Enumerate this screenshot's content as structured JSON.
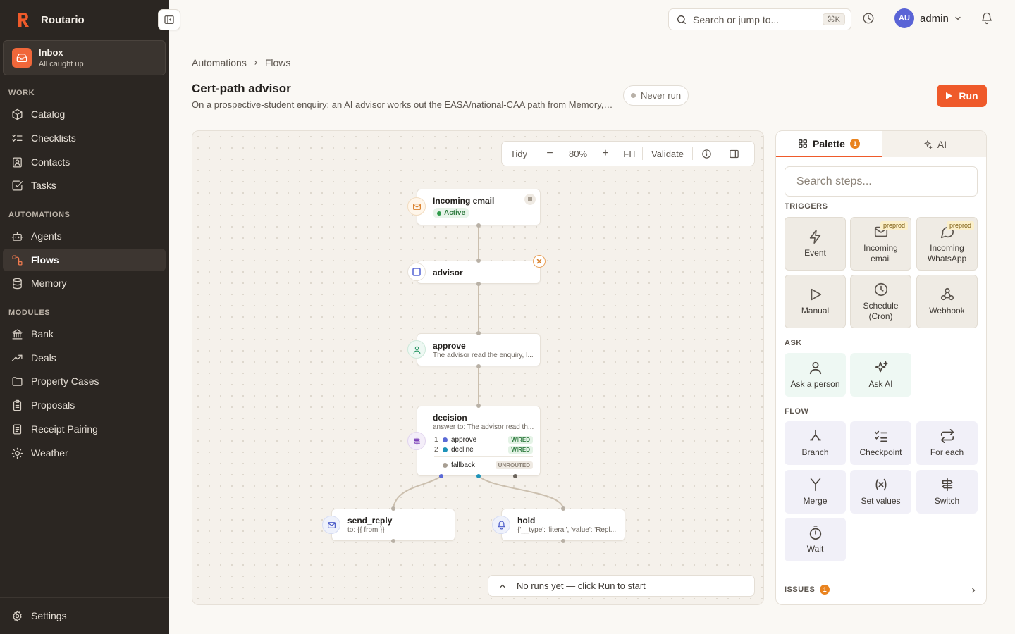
{
  "app": {
    "name": "Routario"
  },
  "inbox": {
    "title": "Inbox",
    "subtitle": "All caught up"
  },
  "sidebar": {
    "sections": [
      {
        "label": "WORK",
        "items": [
          {
            "label": "Catalog",
            "icon": "box-icon"
          },
          {
            "label": "Checklists",
            "icon": "checklist-icon"
          },
          {
            "label": "Contacts",
            "icon": "contacts-icon"
          },
          {
            "label": "Tasks",
            "icon": "tasks-icon"
          }
        ]
      },
      {
        "label": "AUTOMATIONS",
        "items": [
          {
            "label": "Agents",
            "icon": "bot-icon"
          },
          {
            "label": "Flows",
            "icon": "flows-icon",
            "active": true
          },
          {
            "label": "Memory",
            "icon": "database-icon"
          }
        ]
      },
      {
        "label": "MODULES",
        "items": [
          {
            "label": "Bank",
            "icon": "bank-icon"
          },
          {
            "label": "Deals",
            "icon": "trend-icon"
          },
          {
            "label": "Property Cases",
            "icon": "folder-icon"
          },
          {
            "label": "Proposals",
            "icon": "clipboard-icon"
          },
          {
            "label": "Receipt Pairing",
            "icon": "receipt-icon"
          },
          {
            "label": "Weather",
            "icon": "sun-icon"
          }
        ]
      }
    ],
    "settings_label": "Settings"
  },
  "topbar": {
    "search_placeholder": "Search or jump to...",
    "shortcut": "⌘K",
    "avatar_initials": "AU",
    "user_name": "admin"
  },
  "breadcrumb": [
    "Automations",
    "Flows"
  ],
  "page": {
    "title": "Cert-path advisor",
    "description": "On a prospective-student enquiry: an AI advisor works out the EASA/national-CAA path from Memory, logs t...",
    "status": "Never run",
    "run_label": "Run"
  },
  "canvas": {
    "toolbar": {
      "tidy": "Tidy",
      "minus": "−",
      "zoom": "80%",
      "plus": "+",
      "fit": "FIT",
      "validate": "Validate"
    },
    "nodes": {
      "trigger": {
        "title": "Incoming email",
        "badge": "Active"
      },
      "advisor": {
        "title": "advisor"
      },
      "approve": {
        "title": "approve",
        "subtitle": "The advisor read the enquiry, l..."
      },
      "decision": {
        "title": "decision",
        "subtitle": "answer to: The advisor read th...",
        "cases": [
          {
            "num": "1",
            "label": "approve",
            "state": "WIRED",
            "color": "#5b6ad6"
          },
          {
            "num": "2",
            "label": "decline",
            "state": "WIRED",
            "color": "#1e93b8"
          }
        ],
        "fallback": {
          "label": "fallback",
          "state": "UNROUTED"
        }
      },
      "send_reply": {
        "title": "send_reply",
        "subtitle": "to: {{ from }}"
      },
      "hold": {
        "title": "hold",
        "subtitle": "{'__type': 'literal', 'value': 'Repl..."
      }
    },
    "runs_message": "No runs yet — click Run to start"
  },
  "panel": {
    "tabs": {
      "palette": "Palette",
      "palette_count": "1",
      "ai": "AI"
    },
    "search_placeholder": "Search steps...",
    "groups": {
      "triggers": "TRIGGERS",
      "ask": "ASK",
      "flow": "FLOW"
    },
    "triggers": [
      {
        "label": "Event",
        "icon": "bolt-icon"
      },
      {
        "label": "Incoming email",
        "icon": "mail-icon",
        "badge": "preprod"
      },
      {
        "label": "Incoming WhatsApp",
        "icon": "chat-icon",
        "badge": "preprod"
      },
      {
        "label": "Manual",
        "icon": "play-icon"
      },
      {
        "label": "Schedule (Cron)",
        "icon": "clock-icon"
      },
      {
        "label": "Webhook",
        "icon": "webhook-icon"
      }
    ],
    "ask": [
      {
        "label": "Ask a person",
        "icon": "person-icon"
      },
      {
        "label": "Ask AI",
        "icon": "sparkle-icon"
      }
    ],
    "flow": [
      {
        "label": "Branch",
        "icon": "branch-icon"
      },
      {
        "label": "Checkpoint",
        "icon": "checklist-icon"
      },
      {
        "label": "For each",
        "icon": "repeat-icon"
      },
      {
        "label": "Merge",
        "icon": "merge-icon"
      },
      {
        "label": "Set values",
        "icon": "variable-icon"
      },
      {
        "label": "Switch",
        "icon": "signpost-icon"
      },
      {
        "label": "Wait",
        "icon": "timer-icon"
      }
    ],
    "issues_label": "ISSUES",
    "issues_count": "1"
  },
  "colors": {
    "accent": "#ef5a2a",
    "sidebar": "#2b2622",
    "background": "#faf8f4"
  }
}
